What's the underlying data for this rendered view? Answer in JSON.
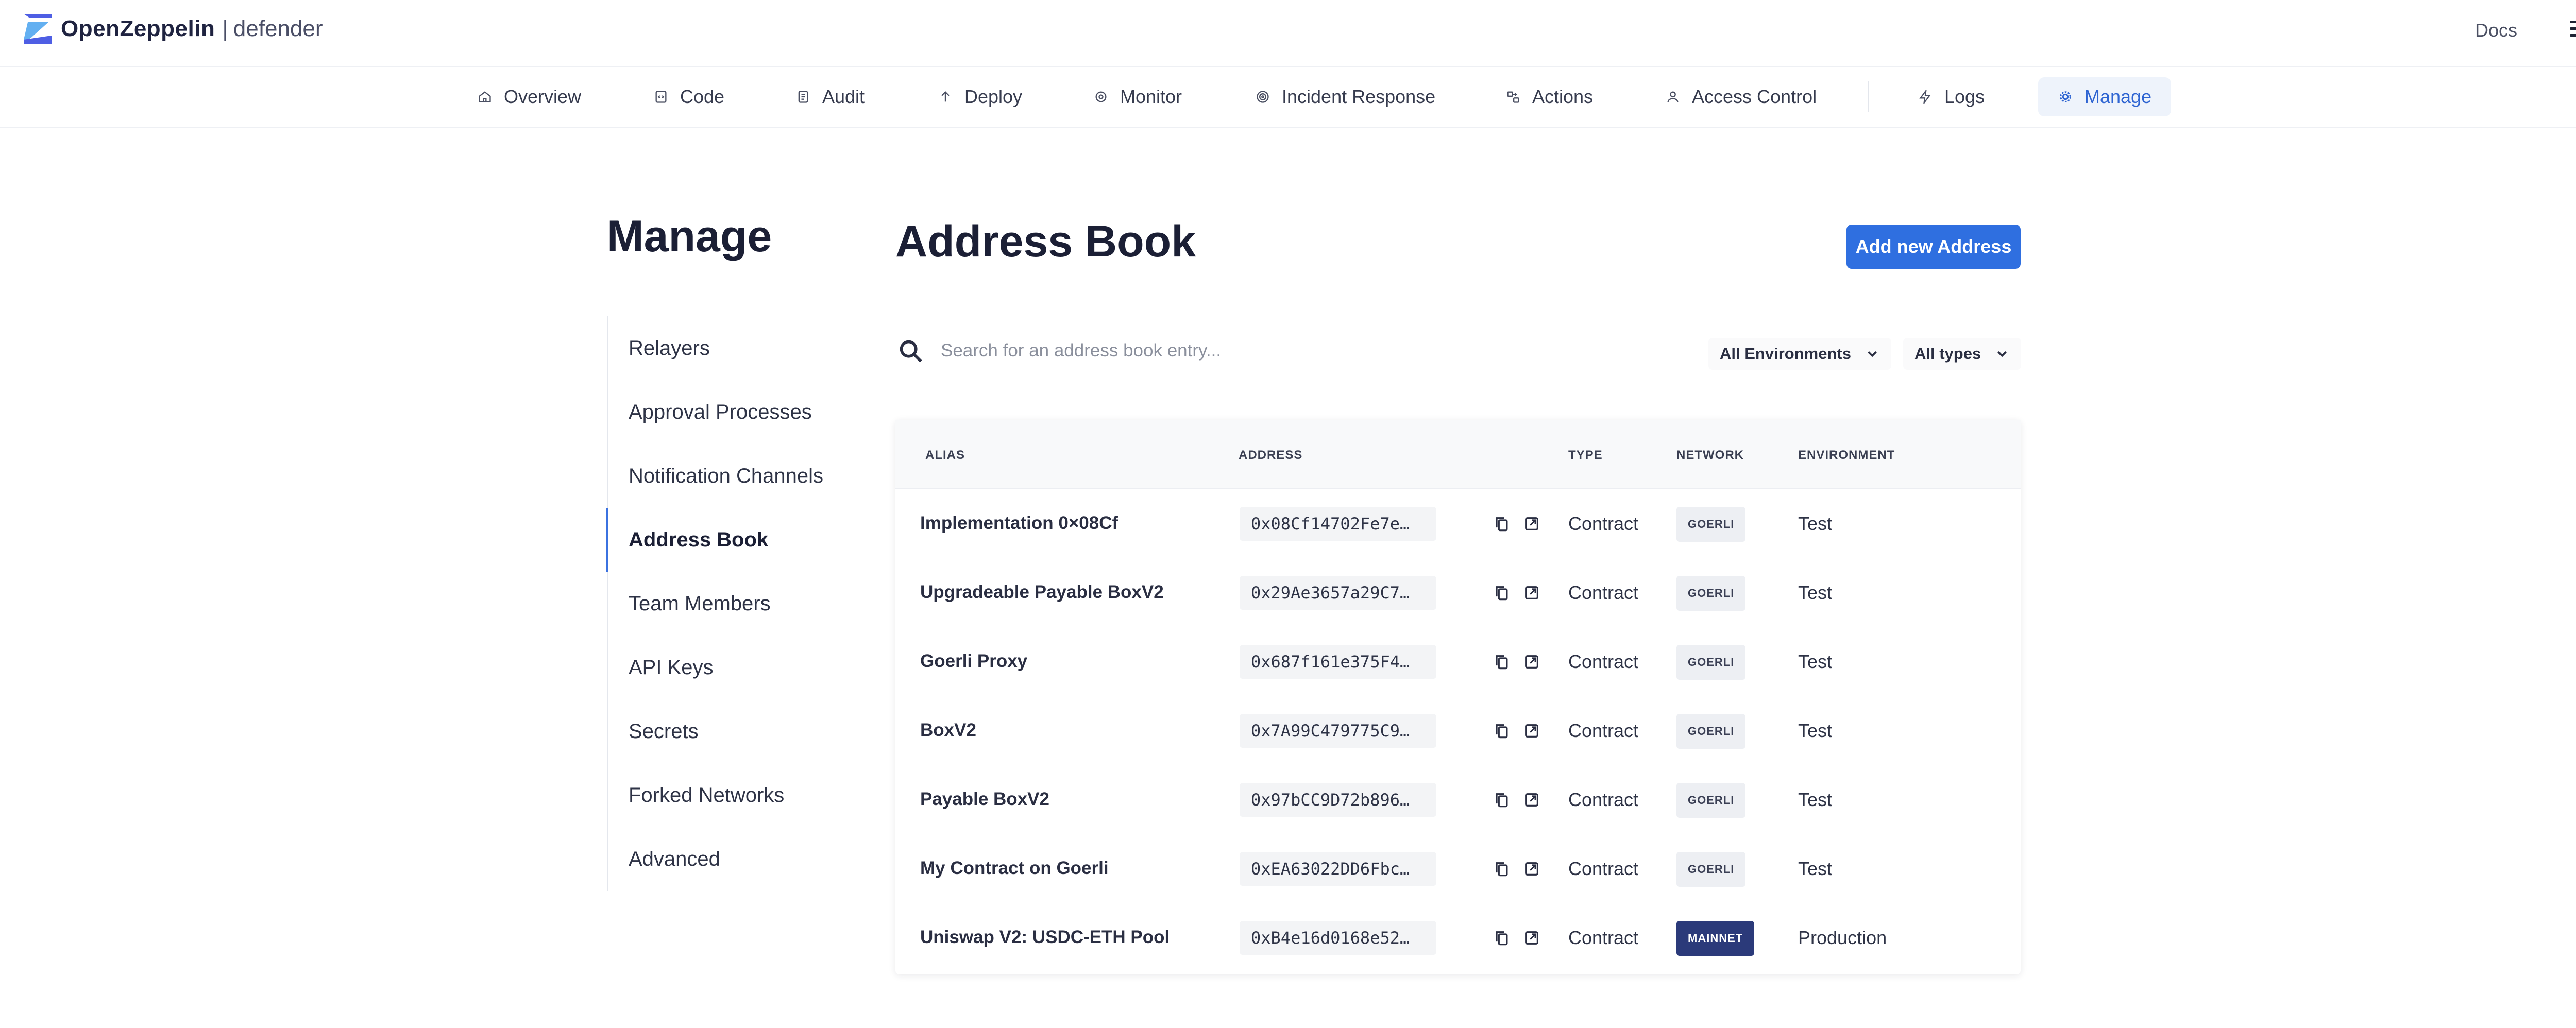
{
  "header": {
    "brand": "OpenZeppelin",
    "separator": "|",
    "product": "defender",
    "docs_label": "Docs"
  },
  "nav": {
    "items": [
      {
        "label": "Overview",
        "icon": "home-icon"
      },
      {
        "label": "Code",
        "icon": "code-icon"
      },
      {
        "label": "Audit",
        "icon": "audit-icon"
      },
      {
        "label": "Deploy",
        "icon": "arrow-up-icon"
      },
      {
        "label": "Monitor",
        "icon": "eye-icon"
      },
      {
        "label": "Incident Response",
        "icon": "target-icon"
      },
      {
        "label": "Actions",
        "icon": "actions-icon"
      },
      {
        "label": "Access Control",
        "icon": "users-icon"
      },
      {
        "label": "Logs",
        "icon": "bolt-icon"
      },
      {
        "label": "Manage",
        "icon": "gear-icon",
        "active": true
      }
    ]
  },
  "sidebar": {
    "title": "Manage",
    "items": [
      {
        "label": "Relayers"
      },
      {
        "label": "Approval Processes"
      },
      {
        "label": "Notification Channels"
      },
      {
        "label": "Address Book",
        "active": true
      },
      {
        "label": "Team Members"
      },
      {
        "label": "API Keys"
      },
      {
        "label": "Secrets"
      },
      {
        "label": "Forked Networks"
      },
      {
        "label": "Advanced"
      }
    ]
  },
  "main": {
    "title": "Address Book",
    "add_button": "Add new Address",
    "search_placeholder": "Search for an address book entry...",
    "filters": {
      "environment": "All Environments",
      "type": "All types"
    }
  },
  "table": {
    "columns": {
      "alias": "ALIAS",
      "address": "ADDRESS",
      "type": "TYPE",
      "network": "NETWORK",
      "environment": "ENVIRONMENT"
    },
    "rows": [
      {
        "alias": "Implementation 0×08Cf",
        "address": "0x08Cf14702Fe7e…",
        "type": "Contract",
        "network": "GOERLI",
        "environment": "Test"
      },
      {
        "alias": "Upgradeable Payable BoxV2",
        "address": "0x29Ae3657a29C7…",
        "type": "Contract",
        "network": "GOERLI",
        "environment": "Test"
      },
      {
        "alias": "Goerli Proxy",
        "address": "0x687f161e375F4…",
        "type": "Contract",
        "network": "GOERLI",
        "environment": "Test"
      },
      {
        "alias": "BoxV2",
        "address": "0x7A99C479775C9…",
        "type": "Contract",
        "network": "GOERLI",
        "environment": "Test"
      },
      {
        "alias": "Payable BoxV2",
        "address": "0x97bCC9D72b896…",
        "type": "Contract",
        "network": "GOERLI",
        "environment": "Test"
      },
      {
        "alias": "My Contract on Goerli",
        "address": "0xEA63022DD6Fbc…",
        "type": "Contract",
        "network": "GOERLI",
        "environment": "Test"
      },
      {
        "alias": "Uniswap V2: USDC-ETH Pool",
        "address": "0xB4e16d0168e52…",
        "type": "Contract",
        "network": "MAINNET",
        "environment": "Production"
      }
    ]
  },
  "colors": {
    "accent": "#2f6fe0",
    "nav_active_bg": "#eef3fb",
    "mainnet_badge": "#2b3a7a",
    "testnet_badge": "#edeff3"
  }
}
